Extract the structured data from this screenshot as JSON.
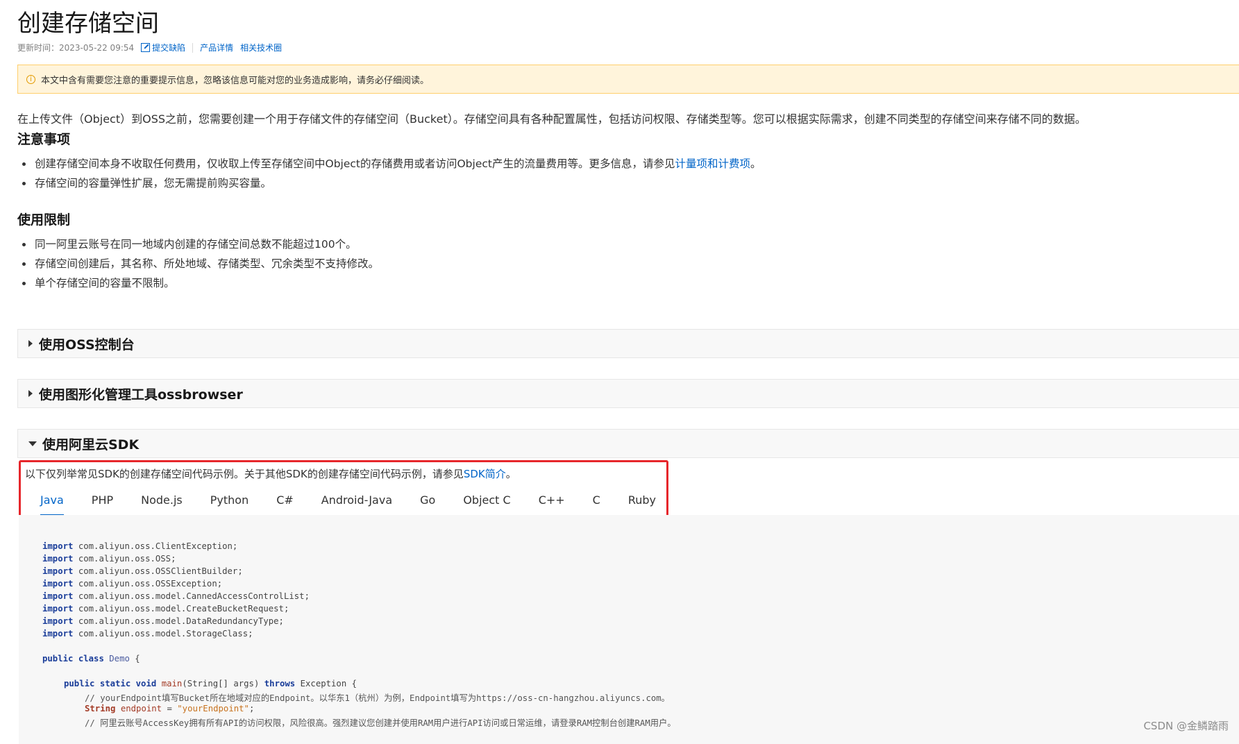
{
  "page": {
    "title": "创建存储空间",
    "meta": {
      "updated": "更新时间：2023-05-22 09:54",
      "report_bug": "提交缺陷",
      "product_detail": "产品详情",
      "tech_circle": "相关技术圈"
    },
    "notice": "本文中含有需要您注意的重要提示信息，忽略该信息可能对您的业务造成影响，请务必仔细阅读。",
    "intro": "在上传文件（Object）到OSS之前，您需要创建一个用于存储文件的存储空间（Bucket）。存储空间具有各种配置属性，包括访问权限、存储类型等。您可以根据实际需求，创建不同类型的存储空间来存储不同的数据。"
  },
  "notes": {
    "title": "注意事项",
    "item1_text": "创建存储空间本身不收取任何费用，仅收取上传至存储空间中Object的存储费用或者访问Object产生的流量费用等。更多信息，请参见",
    "item1_link": "计量项和计费项",
    "item1_end": "。",
    "item2": "存储空间的容量弹性扩展，您无需提前购买容量。"
  },
  "limits": {
    "title": "使用限制",
    "items": [
      "同一阿里云账号在同一地域内创建的存储空间总数不能超过100个。",
      "存储空间创建后，其名称、所处地域、存储类型、冗余类型不支持修改。",
      "单个存储空间的容量不限制。"
    ]
  },
  "sections": {
    "console": "使用OSS控制台",
    "ossbrowser": "使用图形化管理工具ossbrowser",
    "sdk": "使用阿里云SDK"
  },
  "sdk": {
    "desc_text": "以下仅列举常见SDK的创建存储空间代码示例。关于其他SDK的创建存储空间代码示例，请参见",
    "desc_link": "SDK简介",
    "desc_end": "。",
    "tabs": [
      "Java",
      "PHP",
      "Node.js",
      "Python",
      "C#",
      "Android-Java",
      "Go",
      "Object C",
      "C++",
      "C",
      "Ruby"
    ],
    "active_tab": "Java"
  },
  "code": {
    "kw_import": "import",
    "imports": [
      "com.aliyun.oss.ClientException;",
      "com.aliyun.oss.OSS;",
      "com.aliyun.oss.OSSClientBuilder;",
      "com.aliyun.oss.OSSException;",
      "com.aliyun.oss.model.CannedAccessControlList;",
      "com.aliyun.oss.model.CreateBucketRequest;",
      "com.aliyun.oss.model.DataRedundancyType;",
      "com.aliyun.oss.model.StorageClass;"
    ],
    "kw_public": "public",
    "kw_class": "class",
    "class_name": "Demo",
    "brace_open": "{",
    "kw_static": "static",
    "kw_void": "void",
    "fn_main": "main",
    "main_args": "(String[] args)",
    "kw_throws": "throws",
    "exception": "Exception {",
    "comment1": "// yourEndpoint填写Bucket所在地域对应的Endpoint。以华东1（杭州）为例，Endpoint填写为https://oss-cn-hangzhou.aliyuncs.com。",
    "type_string": "String",
    "var_endpoint": "endpoint",
    "assign": " = ",
    "str_endpoint": "\"yourEndpoint\"",
    "semicolon": ";",
    "comment2": "// 阿里云账号AccessKey拥有所有API的访问权限，风险很高。强烈建议您创建并使用RAM用户进行API访问或日常运维，请登录RAM控制台创建RAM用户。"
  },
  "watermark": "CSDN @金鳞踏雨"
}
